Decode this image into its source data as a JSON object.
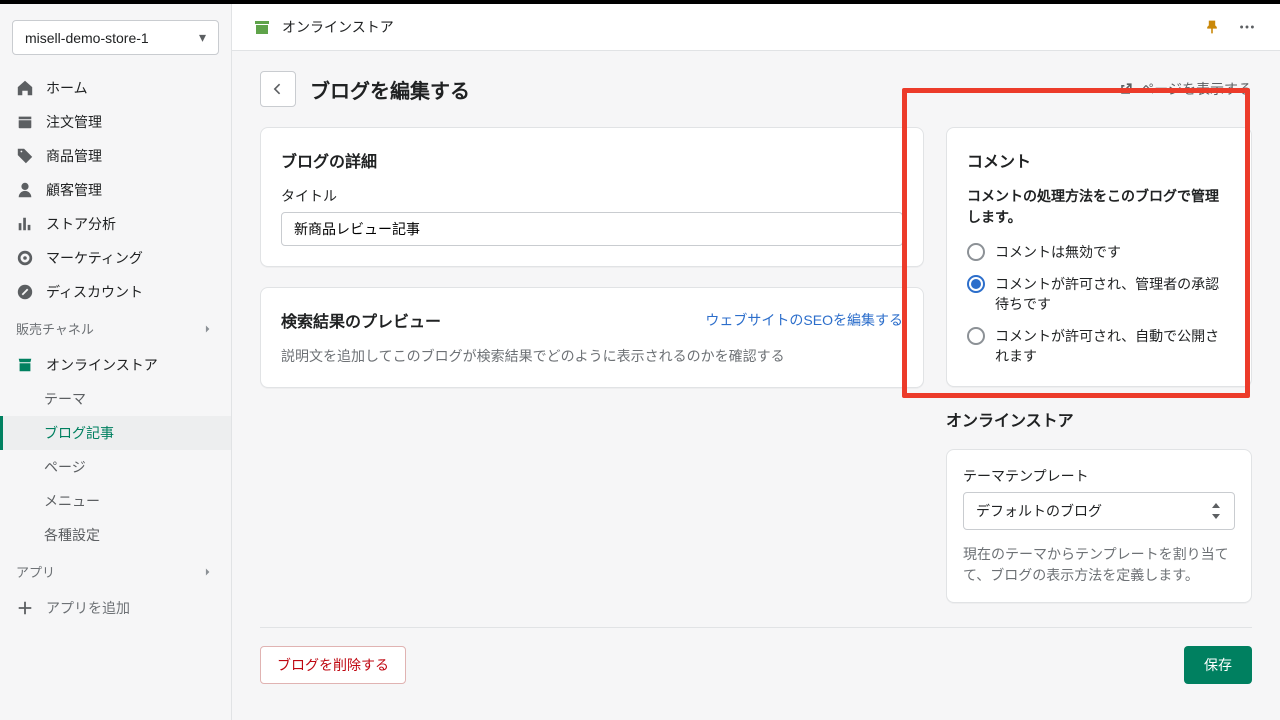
{
  "store_selector": {
    "name": "misell-demo-store-1"
  },
  "sidebar": {
    "items": [
      {
        "label": "ホーム"
      },
      {
        "label": "注文管理"
      },
      {
        "label": "商品管理"
      },
      {
        "label": "顧客管理"
      },
      {
        "label": "ストア分析"
      },
      {
        "label": "マーケティング"
      },
      {
        "label": "ディスカウント"
      }
    ],
    "sales_channel_label": "販売チャネル",
    "online_store": "オンラインストア",
    "sub": [
      {
        "label": "テーマ"
      },
      {
        "label": "ブログ記事"
      },
      {
        "label": "ページ"
      },
      {
        "label": "メニュー"
      },
      {
        "label": "各種設定"
      }
    ],
    "apps_label": "アプリ",
    "add_app": "アプリを追加"
  },
  "topbar": {
    "title": "オンラインストア"
  },
  "page": {
    "title": "ブログを編集する",
    "view_page": "ページを表示する"
  },
  "details": {
    "heading": "ブログの詳細",
    "title_label": "タイトル",
    "title_value": "新商品レビュー記事"
  },
  "seo": {
    "heading": "検索結果のプレビュー",
    "edit_link": "ウェブサイトのSEOを編集する",
    "desc": "説明文を追加してこのブログが検索結果でどのように表示されるのかを確認する"
  },
  "comments": {
    "heading": "コメント",
    "sub": "コメントの処理方法をこのブログで管理します。",
    "options": [
      "コメントは無効です",
      "コメントが許可され、管理者の承認待ちです",
      "コメントが許可され、自動で公開されます"
    ],
    "selected_index": 1
  },
  "online_store_card": {
    "heading": "オンラインストア",
    "template_label": "テーマテンプレート",
    "template_value": "デフォルトのブログ",
    "desc": "現在のテーマからテンプレートを割り当てて、ブログの表示方法を定義します。"
  },
  "footer": {
    "delete": "ブログを削除する",
    "save": "保存"
  }
}
